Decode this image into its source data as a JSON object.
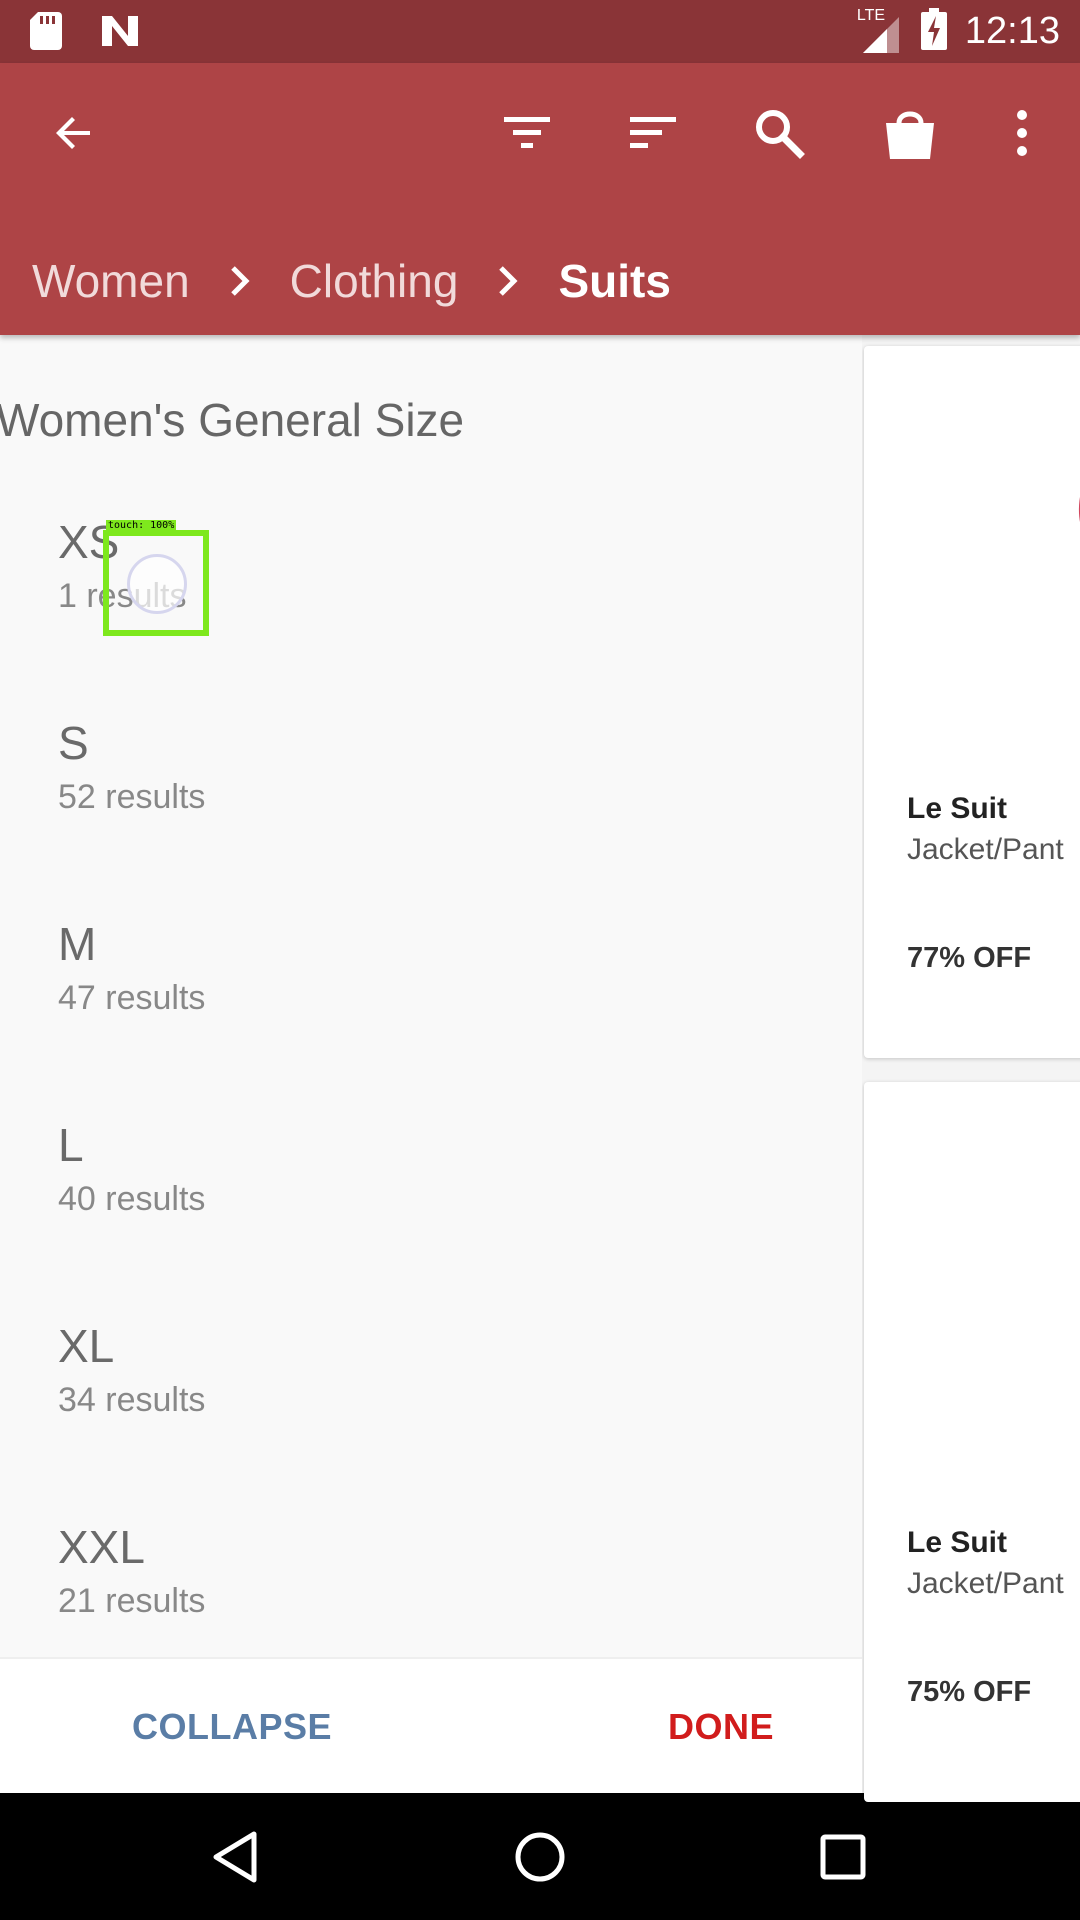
{
  "status_bar": {
    "time": "12:13",
    "network": "LTE",
    "icons": [
      "sd-card-icon",
      "n-notification-icon",
      "signal-icon",
      "battery-charging-icon"
    ]
  },
  "app_bar": {
    "actions": [
      "back-icon",
      "filter-icon",
      "sort-icon",
      "search-icon",
      "shopping-bag-icon",
      "more-vert-icon"
    ],
    "breadcrumb": [
      "Women",
      "Clothing",
      "Suits"
    ]
  },
  "filter_panel": {
    "title": "Women's General Size",
    "sizes": [
      {
        "label": "XS",
        "count": "1 results"
      },
      {
        "label": "S",
        "count": "52 results"
      },
      {
        "label": "M",
        "count": "47 results"
      },
      {
        "label": "L",
        "count": "40 results"
      },
      {
        "label": "XL",
        "count": "34 results"
      },
      {
        "label": "XXL",
        "count": "21 results"
      }
    ],
    "collapse_label": "COLLAPSE",
    "done_label": "DONE",
    "touch_indicator": "touch: 100%"
  },
  "products": [
    {
      "brand": "Le Suit",
      "desc": "Jacket/Pant",
      "discount": "77% OFF"
    },
    {
      "brand": "Le Suit",
      "desc": "Jacket/Pant",
      "discount": "75% OFF"
    }
  ],
  "colors": {
    "status_bar": "#8a3437",
    "app_bar": "#ae4446",
    "collapse": "#5a7da6",
    "done": "#d11c1c",
    "touch_highlight": "#7ee81d"
  },
  "nav_bar": [
    "back-triangle-icon",
    "home-circle-icon",
    "recents-square-icon"
  ]
}
